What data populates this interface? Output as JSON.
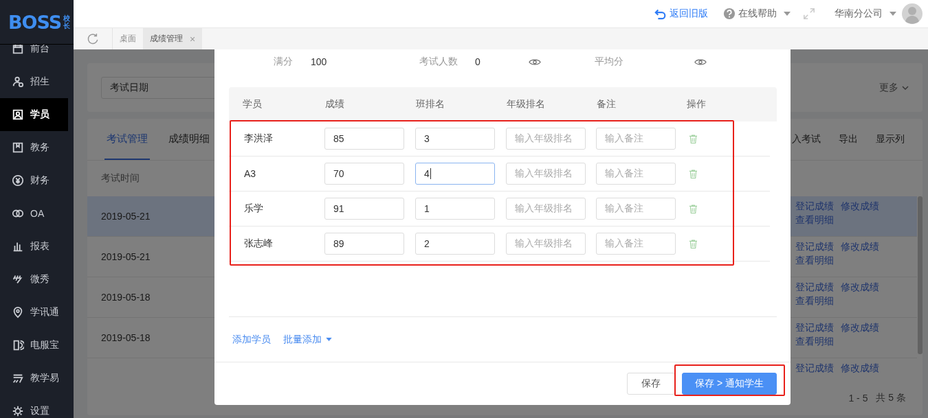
{
  "logo": {
    "text": "BOSS",
    "badge": "校长"
  },
  "top_bar": {
    "back_link": "返回旧版",
    "help": "在线帮助",
    "branch": "华南分公司"
  },
  "page_tabs": [
    {
      "label": "桌面",
      "selected": false
    },
    {
      "label": "成绩管理",
      "selected": true,
      "close": "×"
    }
  ],
  "sidebar": {
    "items": [
      {
        "label": "前台",
        "selected": false
      },
      {
        "label": "招生",
        "selected": false
      },
      {
        "label": "学员",
        "selected": true
      },
      {
        "label": "教务",
        "selected": false
      },
      {
        "label": "财务",
        "selected": false
      },
      {
        "label": "OA",
        "selected": false
      },
      {
        "label": "报表",
        "selected": false
      },
      {
        "label": "微秀",
        "selected": false
      },
      {
        "label": "学讯通",
        "selected": false
      },
      {
        "label": "电服宝",
        "selected": false
      },
      {
        "label": "教学易",
        "selected": false
      },
      {
        "label": "设置",
        "selected": false
      }
    ]
  },
  "filter": {
    "date_select": "考试日期",
    "more": "更多"
  },
  "main": {
    "tabs": [
      {
        "label": "考试管理",
        "selected": true
      },
      {
        "label": "成绩明细",
        "selected": false
      }
    ],
    "actions": [
      "入考试",
      "导出",
      "显示列"
    ],
    "column": "考试时间",
    "rows": [
      {
        "date": "2019-05-21",
        "selected": true,
        "links": [
          "登记成绩",
          "修改成绩",
          "查看明细"
        ]
      },
      {
        "date": "2019-05-21",
        "selected": false,
        "links": [
          "登记成绩",
          "修改成绩",
          "查看明细"
        ]
      },
      {
        "date": "2019-05-18",
        "selected": false,
        "links": [
          "登记成绩",
          "修改成绩",
          "查看明细"
        ]
      },
      {
        "date": "2019-05-18",
        "selected": false,
        "links": [
          "登记成绩",
          "修改成绩",
          "查看明细"
        ]
      },
      {
        "date": null,
        "selected": false,
        "links": [
          "登记成绩",
          "修改成绩"
        ]
      }
    ],
    "pagination": {
      "range": "1 - 5",
      "total": "共 5 条"
    }
  },
  "dialog": {
    "stats": {
      "full_label": "满分",
      "full_value": "100",
      "count_label": "考试人数",
      "count_value": "0",
      "avg_label": "平均分"
    },
    "columns": [
      "学员",
      "成绩",
      "班排名",
      "年级排名",
      "备注",
      "操作"
    ],
    "rows": [
      {
        "name": "李洪泽",
        "score": "85",
        "class_rank": "3",
        "focused": false,
        "grade_rank_placeholder": "输入年级排名",
        "note_placeholder": "输入备注"
      },
      {
        "name": "A3",
        "score": "70",
        "class_rank": "4",
        "focused": true,
        "grade_rank_placeholder": "输入年级排名",
        "note_placeholder": "输入备注"
      },
      {
        "name": "乐学",
        "score": "91",
        "class_rank": "1",
        "focused": false,
        "grade_rank_placeholder": "输入年级排名",
        "note_placeholder": "输入备注"
      },
      {
        "name": "张志峰",
        "score": "89",
        "class_rank": "2",
        "focused": false,
        "grade_rank_placeholder": "输入年级排名",
        "note_placeholder": "输入备注"
      }
    ],
    "add_student": "添加学员",
    "batch_add": "批量添加",
    "buttons": [
      {
        "label": "保存",
        "kind": "default"
      },
      {
        "label": "保存 > 通知学生",
        "kind": "primary"
      }
    ]
  }
}
